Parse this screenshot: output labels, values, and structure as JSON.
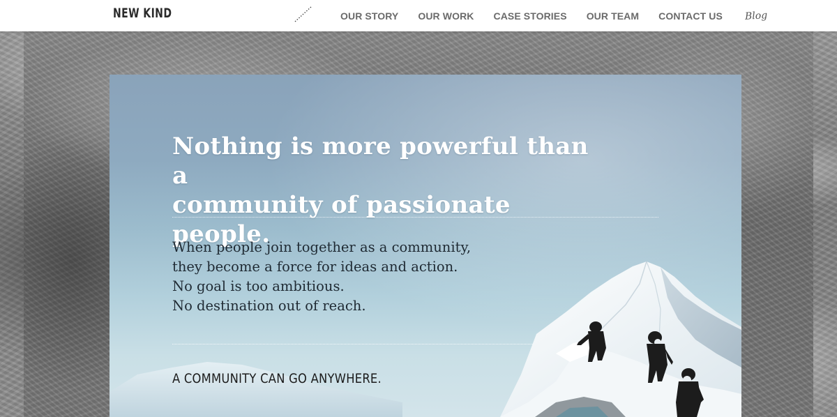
{
  "header": {
    "logo": "NEW KIND",
    "nav": [
      {
        "label": "OUR STORY"
      },
      {
        "label": "OUR WORK"
      },
      {
        "label": "CASE STORIES"
      },
      {
        "label": "OUR TEAM"
      },
      {
        "label": "CONTACT US"
      }
    ],
    "blog_label": "Blog"
  },
  "hero": {
    "headline_line1": "Nothing is more powerful than a",
    "headline_line2": "community of passionate people.",
    "body": [
      "When people join together as a community,",
      "they become a force for ideas and action.",
      "No goal is too ambitious.",
      "No destination out of reach."
    ],
    "tagline": "A COMMUNITY CAN GO ANYWHERE."
  },
  "colors": {
    "header_bg": "#ffffff",
    "nav_text": "#6a6a6a",
    "headline_text": "#ffffff",
    "body_text": "#1f2a33",
    "sky_top": "#8aa3ba",
    "sky_bottom": "#d3e4ea"
  }
}
